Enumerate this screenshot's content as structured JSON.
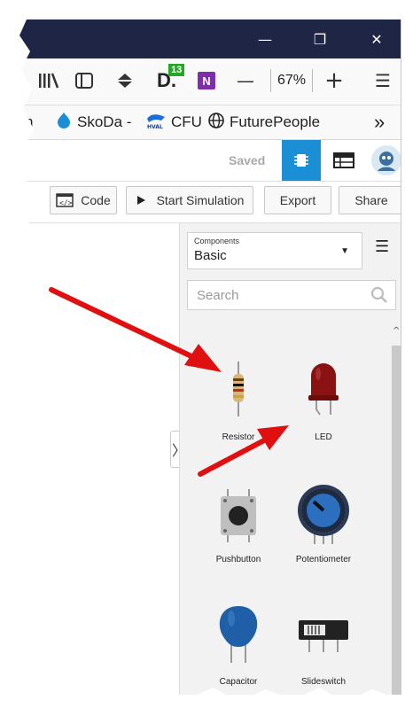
{
  "window": {
    "minimize_glyph": "—",
    "restore_glyph": "❐",
    "close_glyph": "✕"
  },
  "nav": {
    "library_icon": "library-icon",
    "sidebar_icon": "sidebar-icon",
    "badge_count": "13",
    "badge_letter": "D.",
    "onenote_label": "N",
    "zoom_out": "—",
    "zoom_level": "67%",
    "zoom_in": "+",
    "menu_glyph": "☰"
  },
  "bookmarks": {
    "cut_item": "n",
    "items": [
      {
        "label": "SkoDa -"
      },
      {
        "label": "CFU"
      },
      {
        "label": "FuturePeople"
      }
    ],
    "overflow": "»"
  },
  "app": {
    "saved": "Saved"
  },
  "toolbar": {
    "code_label": "Code",
    "start_label": "Start Simulation",
    "export_label": "Export",
    "share_label": "Share"
  },
  "panel": {
    "components_caption": "Components",
    "components_value": "Basic",
    "search_placeholder": "Search",
    "collapse_glyph": "〉",
    "items": [
      {
        "label": "Resistor"
      },
      {
        "label": "LED"
      },
      {
        "label": "Pushbutton"
      },
      {
        "label": "Potentiometer"
      },
      {
        "label": "Capacitor"
      },
      {
        "label": "Slideswitch"
      }
    ]
  },
  "colors": {
    "titlebar": "#1e2545",
    "accent_blue": "#1a8fd6",
    "annotation_arrow": "#e01010",
    "led_red": "#8a1212",
    "capacitor_blue": "#1f5fa8"
  }
}
